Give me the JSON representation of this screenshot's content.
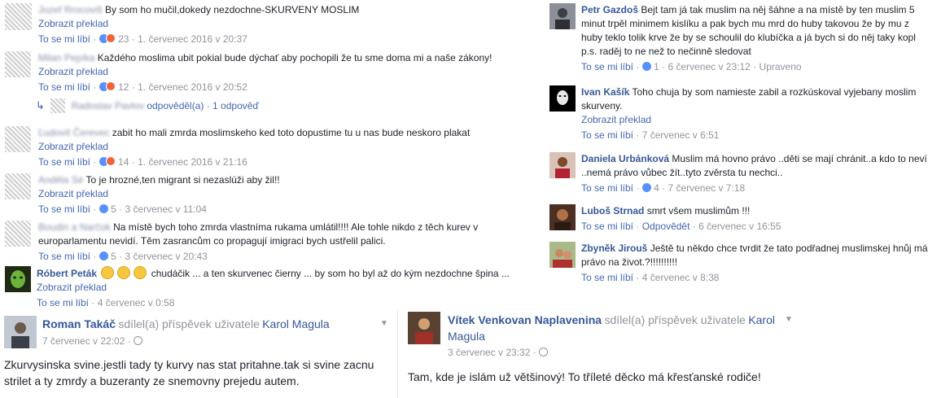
{
  "common": {
    "translate": "Zobrazit překlad",
    "like": "To se mi líbí",
    "dot": "·",
    "reply": "Odpovědět",
    "edited": "Upraveno",
    "like_icon": "like-icon",
    "angry_icon": "angry-icon"
  },
  "left_comments": [
    {
      "name": "Jozef Rrocoviš",
      "text": "By som ho mučil,dokedy nezdochne-SKURVENY MOSLIM",
      "count": "23",
      "time": "1. červenec 2016 v 20:37"
    },
    {
      "name": "Milan Pepíka",
      "text": "Každého moslima ubit pokial bude dýchať aby pochopili že tu sme doma mi a naše zákony!",
      "count": "12",
      "time": "1. červenec 2016 v 20:52"
    },
    {
      "name": "Ľudovít Čerevec",
      "text": "zabit ho mali zmrda moslimskeho ked toto dopustime tu u nas bude neskoro plakat",
      "count": "14",
      "time": "1. červenec 2016 v 21:16"
    },
    {
      "name": "Anděla Sé",
      "text": "To je hrozné,ten migrant si nezaslúži aby žil!!",
      "count": "5",
      "time": "3 červenec v 11:04"
    },
    {
      "name": "Boudin a Narčok",
      "text": "Na místě bych toho zmrda vlastníma rukama umlátil!!!! Ale tohle nikdo z těch kurev v europarlamentu nevidí. Těm zasrancům co propagují imigraci bych ustřelil palici.",
      "count": "5",
      "time": "3 červenec v 20:43"
    },
    {
      "name": "Róbert Peták",
      "text_a": "chudáčik ... a ten skurvenec čierny ... by som ho byl až do kým nezdochne špina ...",
      "time": "4 červenec v 0:58"
    }
  ],
  "reply_line": {
    "name": "Radoslav Pavlov",
    "text": "odpověděl(a) · 1 odpověď"
  },
  "right_comments": [
    {
      "name": "Petr Gazdoš",
      "text": "Bejt tam já tak muslim na něj šáhne a na místě by ten muslim 5 minut trpěl minimem kislíku a pak bych mu mrd do huby takovou že by mu z huby teklo tolik krve že by se schoulil do klubíčka a já bych si do něj taky kopl p.s. raděj to ne než to nečinně sledovat",
      "count": "1",
      "time": "6 červenec v 23:12"
    },
    {
      "name": "Ivan Kašík",
      "text": "Toho chuja by som namieste zabil a rozkúskoval vyjebany moslim skurveny.",
      "time": "7 červenec v 6:51"
    },
    {
      "name": "Daniela Urbánková",
      "text": "Muslim má hovno právo ..děti se mají chránit..a kdo to neví ..nemá právo vůbec žít..tyto zvěrsta tu nechci..",
      "count": "4",
      "time": "7 červenec v 7:18"
    },
    {
      "name": "Luboš Strnad",
      "text": "smrt všem muslimům !!!",
      "time": "6 červenec v 16:55"
    },
    {
      "name": "Zbyněk Jirouš",
      "text": "Ještě tu někdo chce tvrdit že tato podřadnej muslimskej hnůj má právo na život.?!!!!!!!!!!",
      "time": "4 červenec v 8:38"
    }
  ],
  "posts": [
    {
      "name": "Roman Takáč",
      "shared": "sdílel(a) příspěvek uživatele",
      "page": "Karol Magula",
      "time": "7 červenec v 22:02",
      "body": "Zkurvysinska svine.jestli tady ty kurvy nas stat pritahne.tak si svine zacnu strilet a ty zmrdy a buzeranty ze snemovny prejedu autem."
    },
    {
      "name": "Vítek Venkovan Naplavenina",
      "shared": "sdílel(a) příspěvek uživatele",
      "page": "Karol Magula",
      "time": "3 červenec v 23:32",
      "body": "Tam, kde je islám už většinový! To tříleté děcko má křesťanské rodiče!"
    }
  ],
  "colors": {
    "link": "#365899",
    "meta": "#90949c",
    "like": "#5890ff",
    "angry": "#f0643c"
  }
}
